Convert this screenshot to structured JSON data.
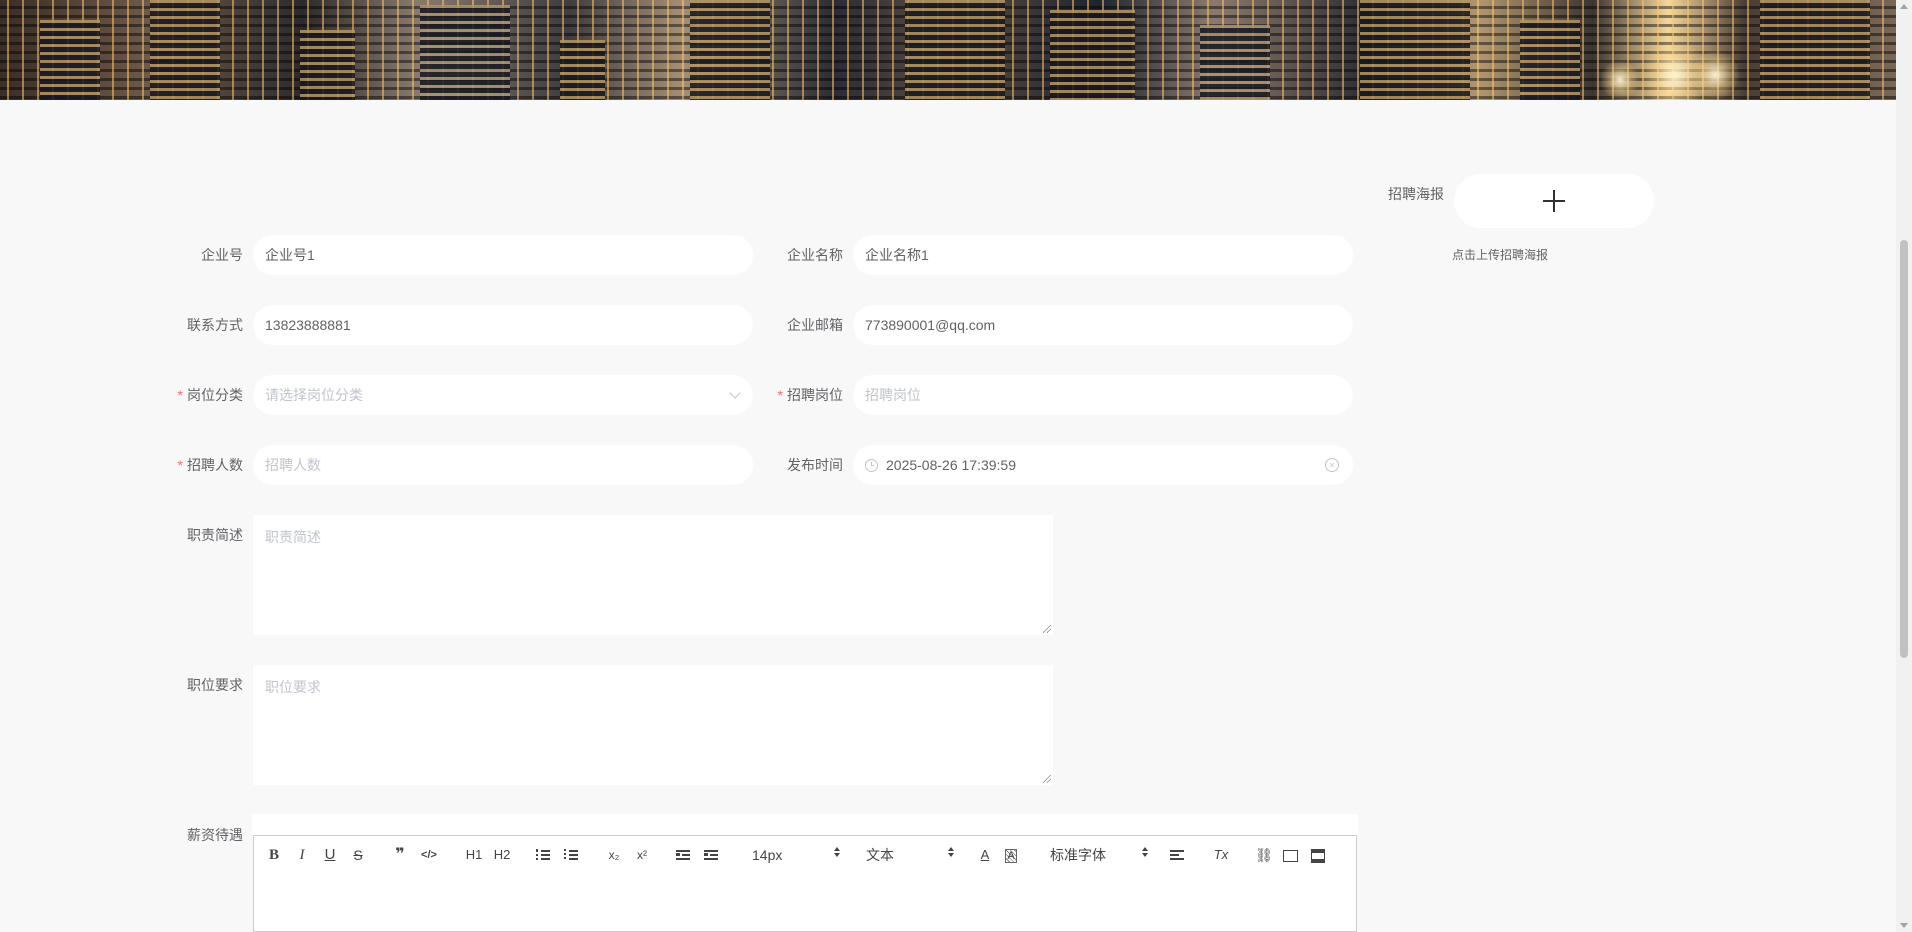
{
  "upload": {
    "label": "招聘海报",
    "tip": "点击上传招聘海报",
    "icon": "plus-icon"
  },
  "form": {
    "company_no": {
      "label": "企业号",
      "value": "企业号1"
    },
    "company_name": {
      "label": "企业名称",
      "value": "企业名称1"
    },
    "contact": {
      "label": "联系方式",
      "value": "13823888881"
    },
    "email": {
      "label": "企业邮箱",
      "value": "773890001@qq.com"
    },
    "job_category": {
      "label": "岗位分类",
      "required": "*",
      "placeholder": "请选择岗位分类"
    },
    "job_title": {
      "label": "招聘岗位",
      "required": "*",
      "placeholder": "招聘岗位"
    },
    "headcount": {
      "label": "招聘人数",
      "required": "*",
      "placeholder": "招聘人数"
    },
    "publish_time": {
      "label": "发布时间",
      "value": "2025-08-26 17:39:59"
    },
    "duties": {
      "label": "职责简述",
      "placeholder": "职责简述"
    },
    "requirements": {
      "label": "职位要求",
      "placeholder": "职位要求"
    },
    "salary": {
      "label": "薪资待遇"
    }
  },
  "editor": {
    "toolbar": {
      "bold": "B",
      "italic": "I",
      "underline": "U",
      "strike": "S",
      "quote": "❞",
      "code": "</>",
      "h1": "H1",
      "h2": "H2",
      "sub": "x₂",
      "sup": "x²",
      "clean": "Tx",
      "font_size": "14px",
      "header": "文本",
      "font_family": "标准字体"
    }
  },
  "colors": {
    "required": "#f56c6c",
    "label": "#606266",
    "placeholder": "#c0c4cc",
    "page_background": "#f8f8f8"
  }
}
